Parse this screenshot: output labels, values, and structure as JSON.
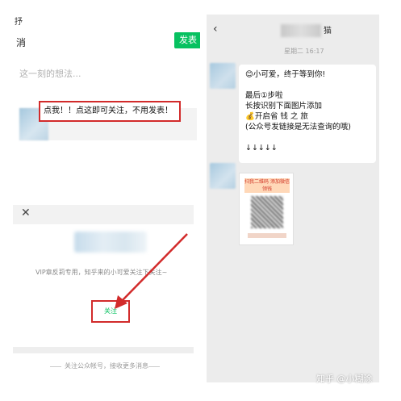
{
  "left": {
    "top_cut_char": "抒",
    "cancel_label": "消",
    "publish_label": "发表",
    "placeholder": "这一刻的想法...",
    "link_text": "点我！！点这即可关注，不用发表！",
    "vip_text": "VIP章反莉专用，知乎来的小可爱关注下关注~",
    "follow_label": "关注",
    "bottom_note": "关注公众帐号，接收更多消息",
    "close_icon": "close-icon"
  },
  "right": {
    "back_icon": "chevron-left-icon",
    "title_suffix": "猫",
    "time": "星期二 16:17",
    "message_lines": [
      "😊小可爱，终于等到你!",
      "",
      "最后①步啦",
      "长按识别下面图片添加",
      "💰开启省 钱 之 旅",
      "(公众号发链接是无法查询的哦)",
      "",
      "↓↓↓↓↓"
    ],
    "image_banner": "扫我二维码\n添加微信领钱"
  },
  "watermark": "知乎 @小糊涂",
  "colors": {
    "accent_green": "#07c160",
    "highlight_red": "#d22b2b",
    "chat_bg": "#ececec"
  }
}
